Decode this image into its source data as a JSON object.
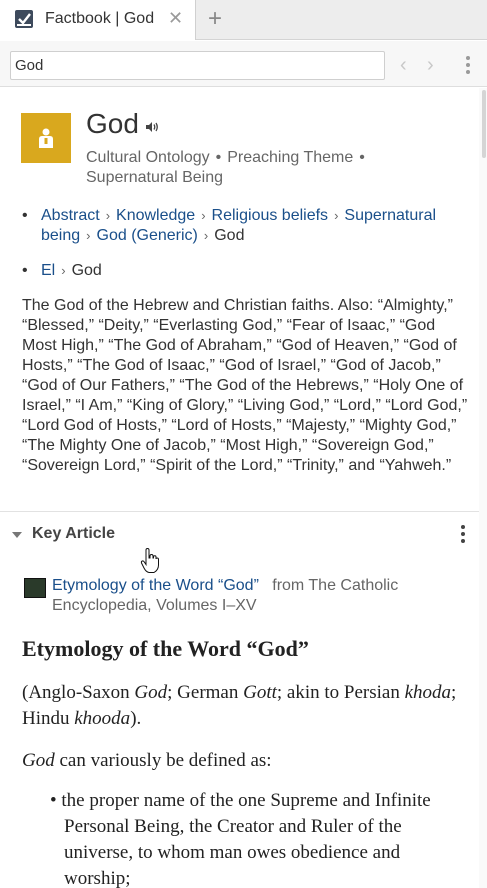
{
  "tab": {
    "title": "Factbook | God",
    "close_icon": "close-icon",
    "new_tab_icon": "plus-icon"
  },
  "toolbar": {
    "search_value": "God",
    "back_icon": "chevron-left-icon",
    "forward_icon": "chevron-right-icon",
    "menu_icon": "more-vertical-icon"
  },
  "entity": {
    "title": "God",
    "icon": "person-icon",
    "icon_color": "#D9A81E",
    "audio_icon": "speaker-icon",
    "types": [
      "Cultural Ontology",
      "Preaching Theme",
      "Supernatural Being"
    ]
  },
  "breadcrumbs": [
    {
      "links": [
        "Abstract",
        "Knowledge",
        "Religious beliefs",
        "Supernatural being",
        "God (Generic)"
      ],
      "current": "God"
    },
    {
      "links": [
        "El"
      ],
      "current": "God"
    }
  ],
  "description": "The God of the Hebrew and Christian faiths. Also: “Almighty,” “Blessed,” “Deity,” “Everlasting God,” “Fear of Isaac,” “God Most High,” “The God of Abraham,” “God of Heaven,” “God of Hosts,” “The God of Isaac,” “God of Israel,” “God of Jacob,” “God of Our Fathers,” “The God of the Hebrews,” “Holy One of Israel,” “I Am,” “King of Glory,” “Living God,” “Lord,” “Lord God,” “Lord God of Hosts,” “Lord of Hosts,” “Majesty,” “Mighty God,” “The Mighty One of Jacob,” “Most High,” “Sovereign God,” “Sovereign Lord,” “Spirit of the Lord,” “Trinity,” and “Yahweh.”",
  "key_article": {
    "section_label": "Key Article",
    "link_text": "Etymology of the Word “God”",
    "from_text": "from The Catholic Encyclopedia, Volumes I–XV"
  },
  "article": {
    "title": "Etymology of the Word “God”",
    "p1_parts": [
      "(Anglo-Saxon ",
      "God",
      "; German ",
      "Gott",
      "; akin to Persian ",
      "khoda",
      "; Hindu ",
      "khooda",
      ")."
    ],
    "p2_parts": [
      "God",
      " can variously be defined as:"
    ],
    "list_item": "the proper name of the one Supreme and Infinite Personal Being, the Creator and Ruler of the universe, to whom man owes obedience and worship;"
  },
  "colors": {
    "link": "#1A4F8A",
    "accent": "#D9A81E"
  }
}
